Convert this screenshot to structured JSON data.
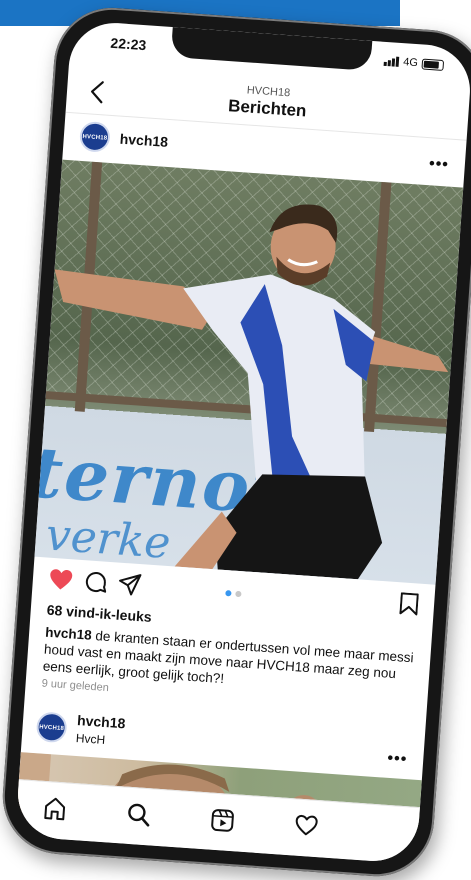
{
  "status": {
    "time": "22:23",
    "network": "4G"
  },
  "header": {
    "account": "HVCH18",
    "title": "Berichten"
  },
  "post": {
    "username": "hvch18",
    "board_text": "ternoi",
    "board_text2": "verke",
    "likes": "68 vind-ik-leuks",
    "caption_user": "hvch18",
    "caption_text": " de kranten staan er ondertussen vol mee maar messi houd vast en maakt zijn move naar HVCH18 maar zeg nou eens eerlijk, groot gelijk toch?!",
    "time_ago": "9 uur geleden",
    "avatar_text": "HVCH18",
    "like_color": "#ed4956"
  },
  "post2": {
    "username": "hvch18",
    "subtitle": "HvcH",
    "avatar_text": "HVCH18"
  },
  "tabbar": {
    "items": [
      "home-icon",
      "search-icon",
      "reels-icon",
      "activity-icon"
    ]
  }
}
